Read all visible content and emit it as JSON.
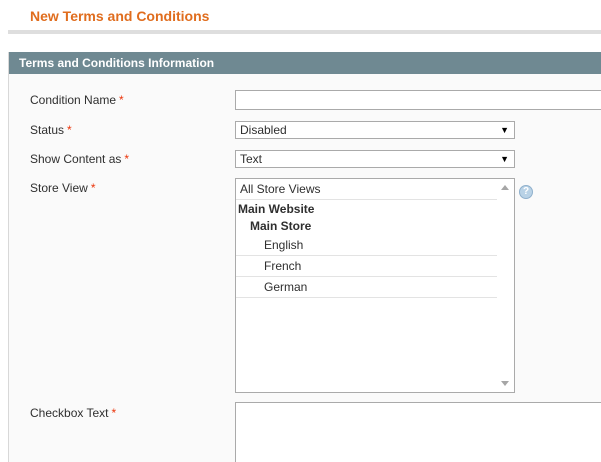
{
  "page": {
    "title": "New Terms and Conditions"
  },
  "section": {
    "title": "Terms and Conditions Information"
  },
  "form": {
    "required_mark": "*",
    "condition_name": {
      "label": "Condition Name",
      "value": ""
    },
    "status": {
      "label": "Status",
      "selected": "Disabled"
    },
    "show_content_as": {
      "label": "Show Content as",
      "selected": "Text"
    },
    "store_view": {
      "label": "Store View",
      "all_option": "All Store Views",
      "website": "Main Website",
      "store": "Main Store",
      "views": [
        "English",
        "French",
        "German"
      ]
    },
    "checkbox_text": {
      "label": "Checkbox Text",
      "value": ""
    }
  },
  "icons": {
    "dropdown": "chevron-down-icon",
    "help": "help-icon",
    "help_glyph": "?",
    "dropdown_glyph": "▼"
  },
  "colors": {
    "title": "#e06d1e",
    "section_header": "#6f8992",
    "required": "#eb340a"
  }
}
